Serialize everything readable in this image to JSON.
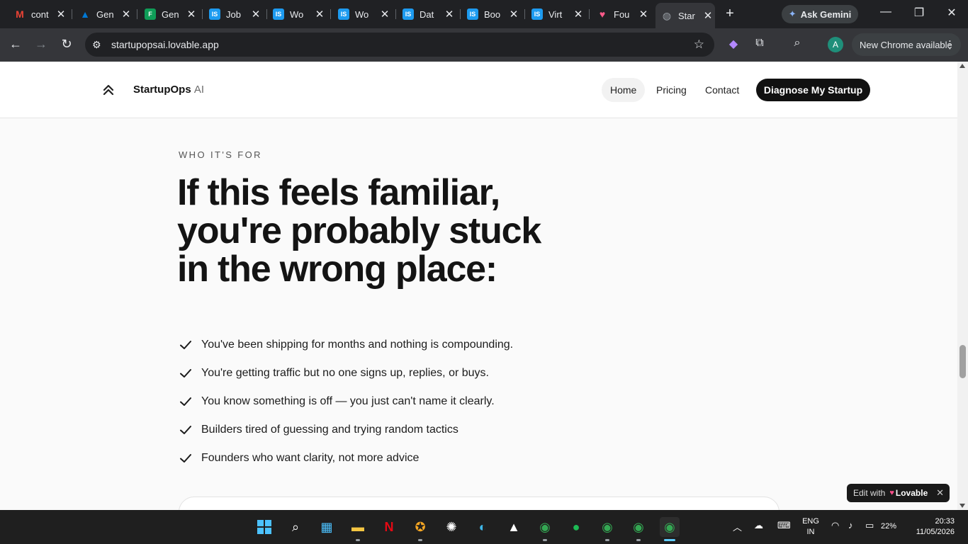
{
  "browser": {
    "tabs": [
      {
        "title": "cont",
        "favicon": "gmail-icon",
        "color": "#ea4335",
        "glyph": "M"
      },
      {
        "title": "Gen",
        "favicon": "azure-icon",
        "color": "#0078d4",
        "glyph": "▲"
      },
      {
        "title": "Gen",
        "favicon": "sheets-icon",
        "color": "#0f9d58",
        "glyph": "F"
      },
      {
        "title": "Job",
        "favicon": "is-icon",
        "color": "#1d9bf0",
        "glyph": "IS"
      },
      {
        "title": "Wo",
        "favicon": "is-icon",
        "color": "#1d9bf0",
        "glyph": "IS"
      },
      {
        "title": "Wo",
        "favicon": "is-icon",
        "color": "#1d9bf0",
        "glyph": "IS"
      },
      {
        "title": "Dat",
        "favicon": "is-icon",
        "color": "#1d9bf0",
        "glyph": "IS"
      },
      {
        "title": "Boo",
        "favicon": "is-icon",
        "color": "#1d9bf0",
        "glyph": "IS"
      },
      {
        "title": "Virt",
        "favicon": "is-icon",
        "color": "#1d9bf0",
        "glyph": "IS"
      },
      {
        "title": "Fou",
        "favicon": "lovable-icon",
        "color": "#ff5a8a",
        "glyph": "♥"
      },
      {
        "title": "Star",
        "favicon": "globe-icon",
        "color": "#9aa0a6",
        "glyph": "◍",
        "active": true
      }
    ],
    "ask_gemini": "Ask Gemini",
    "url": "startupopsai.lovable.app",
    "new_chrome": "New Chrome available",
    "profile_initial": "A"
  },
  "site": {
    "brand_main": "StartupOps",
    "brand_suffix": "AI",
    "nav": {
      "home": "Home",
      "pricing": "Pricing",
      "contact": "Contact"
    },
    "cta": "Diagnose My Startup",
    "section": {
      "eyebrow": "WHO IT'S FOR",
      "headline_lines": [
        "If this feels familiar,",
        "you're probably stuck",
        "in the wrong place:"
      ],
      "checklist": [
        "You've been shipping for months and nothing is compounding.",
        "You're getting traffic but no one signs up, replies, or buys.",
        "You know something is off — you just can't name it clearly.",
        "Builders tired of guessing and trying random tactics",
        "Founders who want clarity, not more advice"
      ]
    },
    "lovable_badge": {
      "prefix": "Edit with",
      "brand": "Lovable"
    }
  },
  "taskbar": {
    "lang_line1": "ENG",
    "lang_line2": "IN",
    "battery": "22%",
    "time": "20:33",
    "date": "11/05/2026"
  }
}
